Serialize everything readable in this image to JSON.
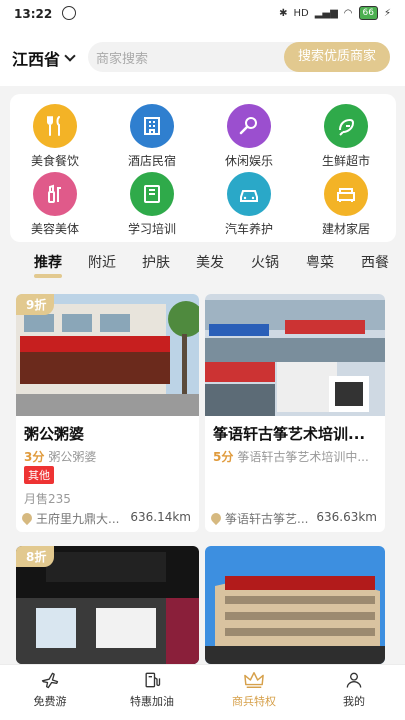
{
  "status": {
    "time": "13:22",
    "battery": "66",
    "network": "HD",
    "speed": "4G"
  },
  "header": {
    "city": "江西省",
    "search_placeholder": "商家搜索",
    "search_button": "搜索优质商家"
  },
  "categories": [
    {
      "label": "美食餐饮",
      "icon": "utensils-icon",
      "color": "#f3b326"
    },
    {
      "label": "酒店民宿",
      "icon": "hotel-icon",
      "color": "#2f7fcf"
    },
    {
      "label": "休闲娱乐",
      "icon": "microphone-icon",
      "color": "#9b4fcf"
    },
    {
      "label": "生鲜超市",
      "icon": "shrimp-icon",
      "color": "#2faa4a"
    },
    {
      "label": "美容美体",
      "icon": "beauty-icon",
      "color": "#e05a8a"
    },
    {
      "label": "学习培训",
      "icon": "book-icon",
      "color": "#2faa4a"
    },
    {
      "label": "汽车养护",
      "icon": "car-icon",
      "color": "#2aa8c8"
    },
    {
      "label": "建材家居",
      "icon": "sofa-icon",
      "color": "#f3b326"
    }
  ],
  "tabs": [
    "推荐",
    "附近",
    "护肤",
    "美发",
    "火锅",
    "粤菜",
    "西餐"
  ],
  "cards": [
    {
      "discount": "9折",
      "title": "粥公粥婆",
      "score": "3分",
      "sub": "粥公粥婆",
      "tag": "其他",
      "hours": "月售235",
      "location": "王府里九鼎大...",
      "distance": "636.14km"
    },
    {
      "discount": "",
      "title": "筝语轩古筝艺术培训...",
      "score": "5分",
      "sub": "筝语轩古筝艺术培训中...",
      "tag": "",
      "hours": "",
      "location": "筝语轩古筝艺...",
      "distance": "636.63km"
    },
    {
      "discount": "8折"
    },
    {
      "discount": ""
    }
  ],
  "nav": [
    {
      "label": "免费游",
      "icon": "plane-icon"
    },
    {
      "label": "特惠加油",
      "icon": "fuel-icon"
    },
    {
      "label": "商兵特权",
      "icon": "crown-icon"
    },
    {
      "label": "我的",
      "icon": "user-icon"
    }
  ],
  "colors": {
    "accent": "#e2c98f",
    "active_nav": "#d6a04a",
    "tag_red": "#e33"
  }
}
